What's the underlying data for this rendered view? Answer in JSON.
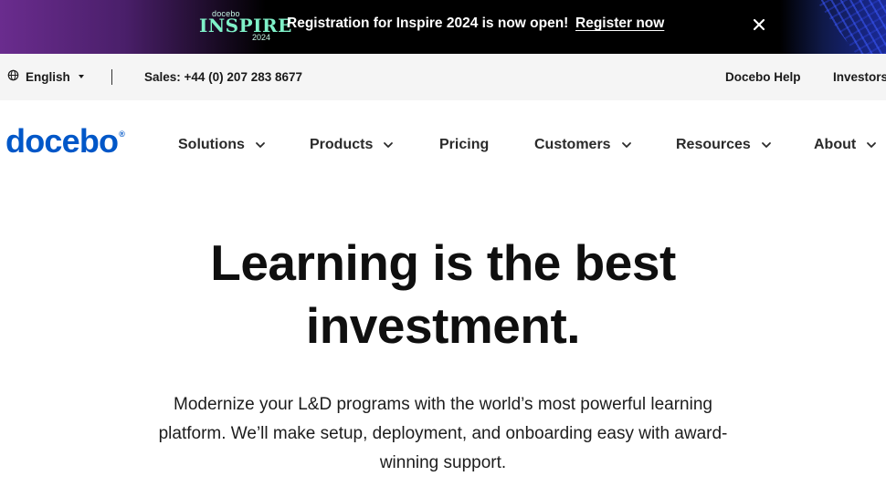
{
  "banner": {
    "logo_small": "docebo",
    "logo_big": "INSPIRE",
    "logo_year": "2024",
    "message": "Registration for Inspire 2024 is now open!",
    "cta": "Register now",
    "close_icon": "close-icon"
  },
  "utility": {
    "language": "English",
    "sales": "Sales: +44 (0) 207 283 8677",
    "help": "Docebo Help",
    "investors": "Investors"
  },
  "nav": {
    "brand": "docebo",
    "items": [
      {
        "label": "Solutions",
        "has_dropdown": true
      },
      {
        "label": "Products",
        "has_dropdown": true
      },
      {
        "label": "Pricing",
        "has_dropdown": false
      },
      {
        "label": "Customers",
        "has_dropdown": true
      },
      {
        "label": "Resources",
        "has_dropdown": true
      },
      {
        "label": "About",
        "has_dropdown": true
      }
    ]
  },
  "hero": {
    "title_line1": "Learning is the best",
    "title_line2": "investment.",
    "subtitle": "Modernize your L&D programs with the world’s most powerful learning platform. We’ll make setup, deployment, and onboarding easy with award-winning support."
  },
  "colors": {
    "brand": "#0057c8",
    "banner_accent": "#7ff0c8",
    "banner_purple": "#6a2c8e"
  }
}
